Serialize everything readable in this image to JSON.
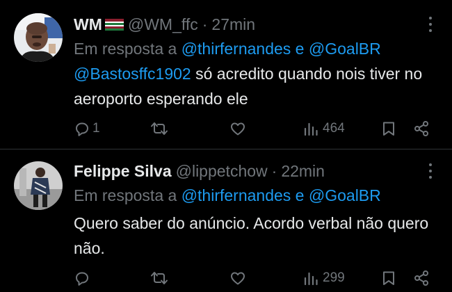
{
  "tweets": [
    {
      "name": "WM",
      "flag_icon": "fluminense-flag-icon",
      "handle": "@WM_ffc",
      "separator": "·",
      "time": "27min",
      "reply_prefix": "Em resposta a ",
      "reply_user_1": "@thirfernandes",
      "reply_joiner": " e ",
      "reply_user_2": "@GoalBR",
      "mention": "@Bastosffc1902",
      "text": " só acredito quando nois tiver no aeroporto esperando ele",
      "replies": "1",
      "reposts": "",
      "likes": "",
      "views": "464"
    },
    {
      "name": "Felippe Silva",
      "handle": "@lippetchow",
      "separator": "·",
      "time": "22min",
      "reply_prefix": "Em resposta a ",
      "reply_user_1": "@thirfernandes",
      "reply_joiner": " e ",
      "reply_user_2": "@GoalBR",
      "text": "Quero saber do anúncio. Acordo verbal não quero não.",
      "replies": "",
      "reposts": "",
      "likes": "",
      "views": "299"
    }
  ],
  "colors": {
    "background": "#000000",
    "text": "#e7e9ea",
    "muted": "#71767b",
    "link": "#1d9bf0",
    "divider": "#2f3336"
  }
}
